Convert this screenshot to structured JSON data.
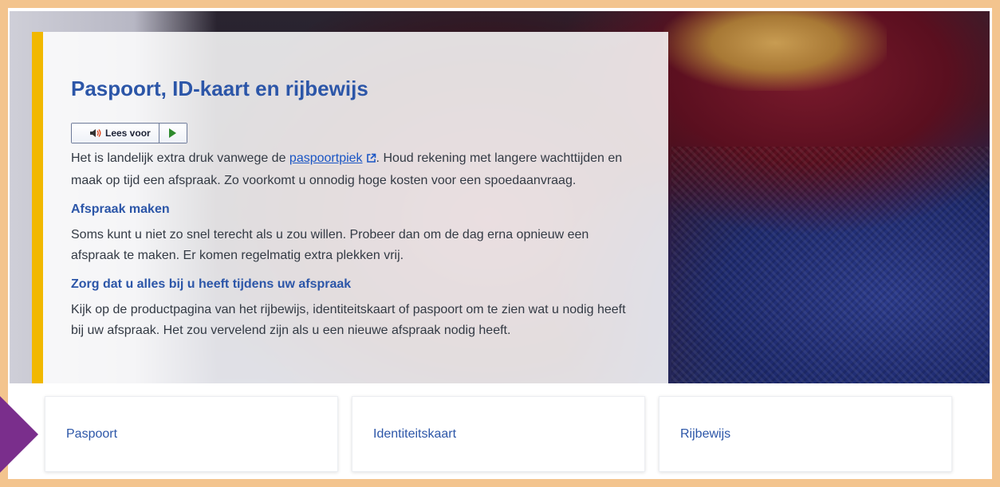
{
  "page": {
    "title": "Paspoort, ID-kaart en rijbewijs",
    "read_aloud_label": "Lees voor",
    "intro_part1": "Het is landelijk extra druk vanwege de ",
    "intro_link": "paspoortpiek",
    "intro_part2": ". Houd rekening met langere wachttijden en maak op tijd een afspraak. Zo voorkomt u onnodig hoge kosten voor een spoedaanvraag.",
    "section1_title": "Afspraak maken",
    "section1_text": "Soms kunt u niet zo snel terecht als u zou willen. Probeer dan om de dag erna opnieuw een afspraak te maken. Er komen regelmatig extra plekken vrij.",
    "section2_title": "Zorg dat u alles bij u heeft tijdens uw afspraak",
    "section2_text": "Kijk op de productpagina van het rijbewijs, identiteitskaart of paspoort om te zien wat u nodig heeft bij uw afspraak. Het zou vervelend zijn als u een nieuwe afspraak nodig heeft."
  },
  "cards": [
    {
      "label": "Paspoort"
    },
    {
      "label": "Identiteitskaart"
    },
    {
      "label": "Rijbewijs"
    }
  ],
  "colors": {
    "accent": "#f1b800",
    "heading": "#2c56a8",
    "border": "#f3c48e",
    "arrow": "#7a2e8c"
  },
  "icons": [
    "speaker-icon",
    "play-icon",
    "external-link-icon",
    "arrow-pointer-icon"
  ]
}
